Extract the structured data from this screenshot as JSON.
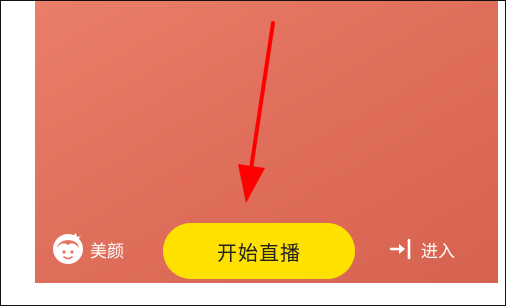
{
  "controls": {
    "beauty": {
      "label": "美颜",
      "icon": "face-beauty-icon"
    },
    "start_live": {
      "label": "开始直播"
    },
    "enter": {
      "label": "进入",
      "icon": "enter-arrow-icon"
    }
  },
  "colors": {
    "preview_background": "#e47562",
    "start_button": "#ffe100",
    "annotation_arrow": "#ff0000"
  }
}
